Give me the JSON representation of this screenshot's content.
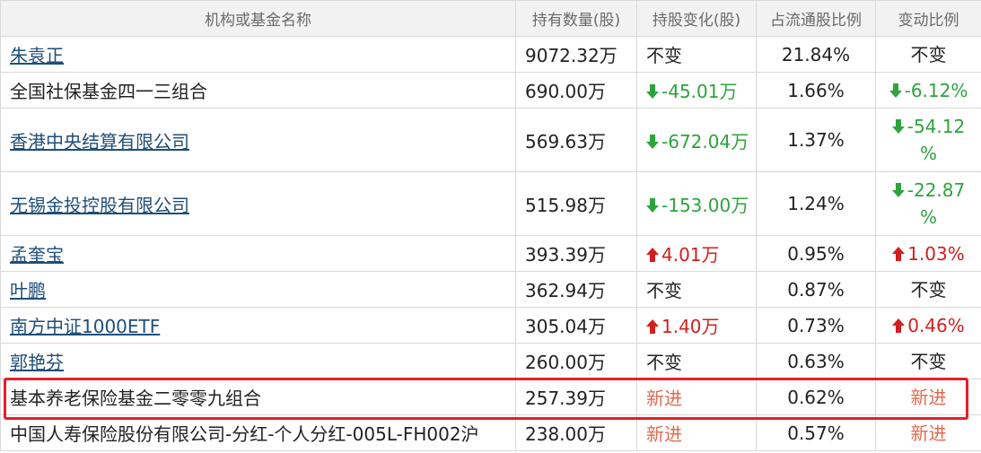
{
  "table": {
    "headers": [
      "机构或基金名称",
      "持有数量(股)",
      "持股变化(股)",
      "占流通股比例",
      "变动比例"
    ],
    "rows": [
      {
        "name": "朱袁正",
        "link": true,
        "qty": "9072.32万",
        "change": "不变",
        "change_dir": "same",
        "ratio": "21.84%",
        "var": "不变",
        "var_dir": "same"
      },
      {
        "name": "全国社保基金四一三组合",
        "link": false,
        "qty": "690.00万",
        "change": "-45.01万",
        "change_dir": "down",
        "ratio": "1.66%",
        "var": "-6.12%",
        "var_dir": "down"
      },
      {
        "name": "香港中央结算有限公司",
        "link": true,
        "qty": "569.63万",
        "change": "-672.04万",
        "change_dir": "down",
        "ratio": "1.37%",
        "var": "-54.12%",
        "var_dir": "down"
      },
      {
        "name": "无锡金投控股有限公司",
        "link": true,
        "qty": "515.98万",
        "change": "-153.00万",
        "change_dir": "down",
        "ratio": "1.24%",
        "var": "-22.87%",
        "var_dir": "down"
      },
      {
        "name": "孟奎宝",
        "link": true,
        "qty": "393.39万",
        "change": "4.01万",
        "change_dir": "up",
        "ratio": "0.95%",
        "var": "1.03%",
        "var_dir": "up"
      },
      {
        "name": "叶鹏",
        "link": true,
        "qty": "362.94万",
        "change": "不变",
        "change_dir": "same",
        "ratio": "0.87%",
        "var": "不变",
        "var_dir": "same"
      },
      {
        "name": "南方中证1000ETF",
        "link": true,
        "qty": "305.04万",
        "change": "1.40万",
        "change_dir": "up",
        "ratio": "0.73%",
        "var": "0.46%",
        "var_dir": "up"
      },
      {
        "name": "郭艳芬",
        "link": true,
        "qty": "260.00万",
        "change": "不变",
        "change_dir": "same",
        "ratio": "0.63%",
        "var": "不变",
        "var_dir": "same"
      },
      {
        "name": "基本养老保险基金二零零九组合",
        "link": false,
        "qty": "257.39万",
        "change": "新进",
        "change_dir": "new",
        "ratio": "0.62%",
        "var": "新进",
        "var_dir": "new"
      },
      {
        "name": "中国人寿保险股份有限公司-分红-个人分红-005L-FH002沪",
        "link": false,
        "qty": "238.00万",
        "change": "新进",
        "change_dir": "new",
        "ratio": "0.57%",
        "var": "新进",
        "var_dir": "new"
      }
    ]
  },
  "colors": {
    "link": "#1f4e79",
    "down": "#2ea33c",
    "up": "#d21e1e",
    "new": "#e06a50",
    "highlight_border": "#e3202b",
    "header_bg": "#f2f2f2"
  },
  "icons": {
    "down": "arrow-down-icon",
    "up": "arrow-up-icon"
  }
}
